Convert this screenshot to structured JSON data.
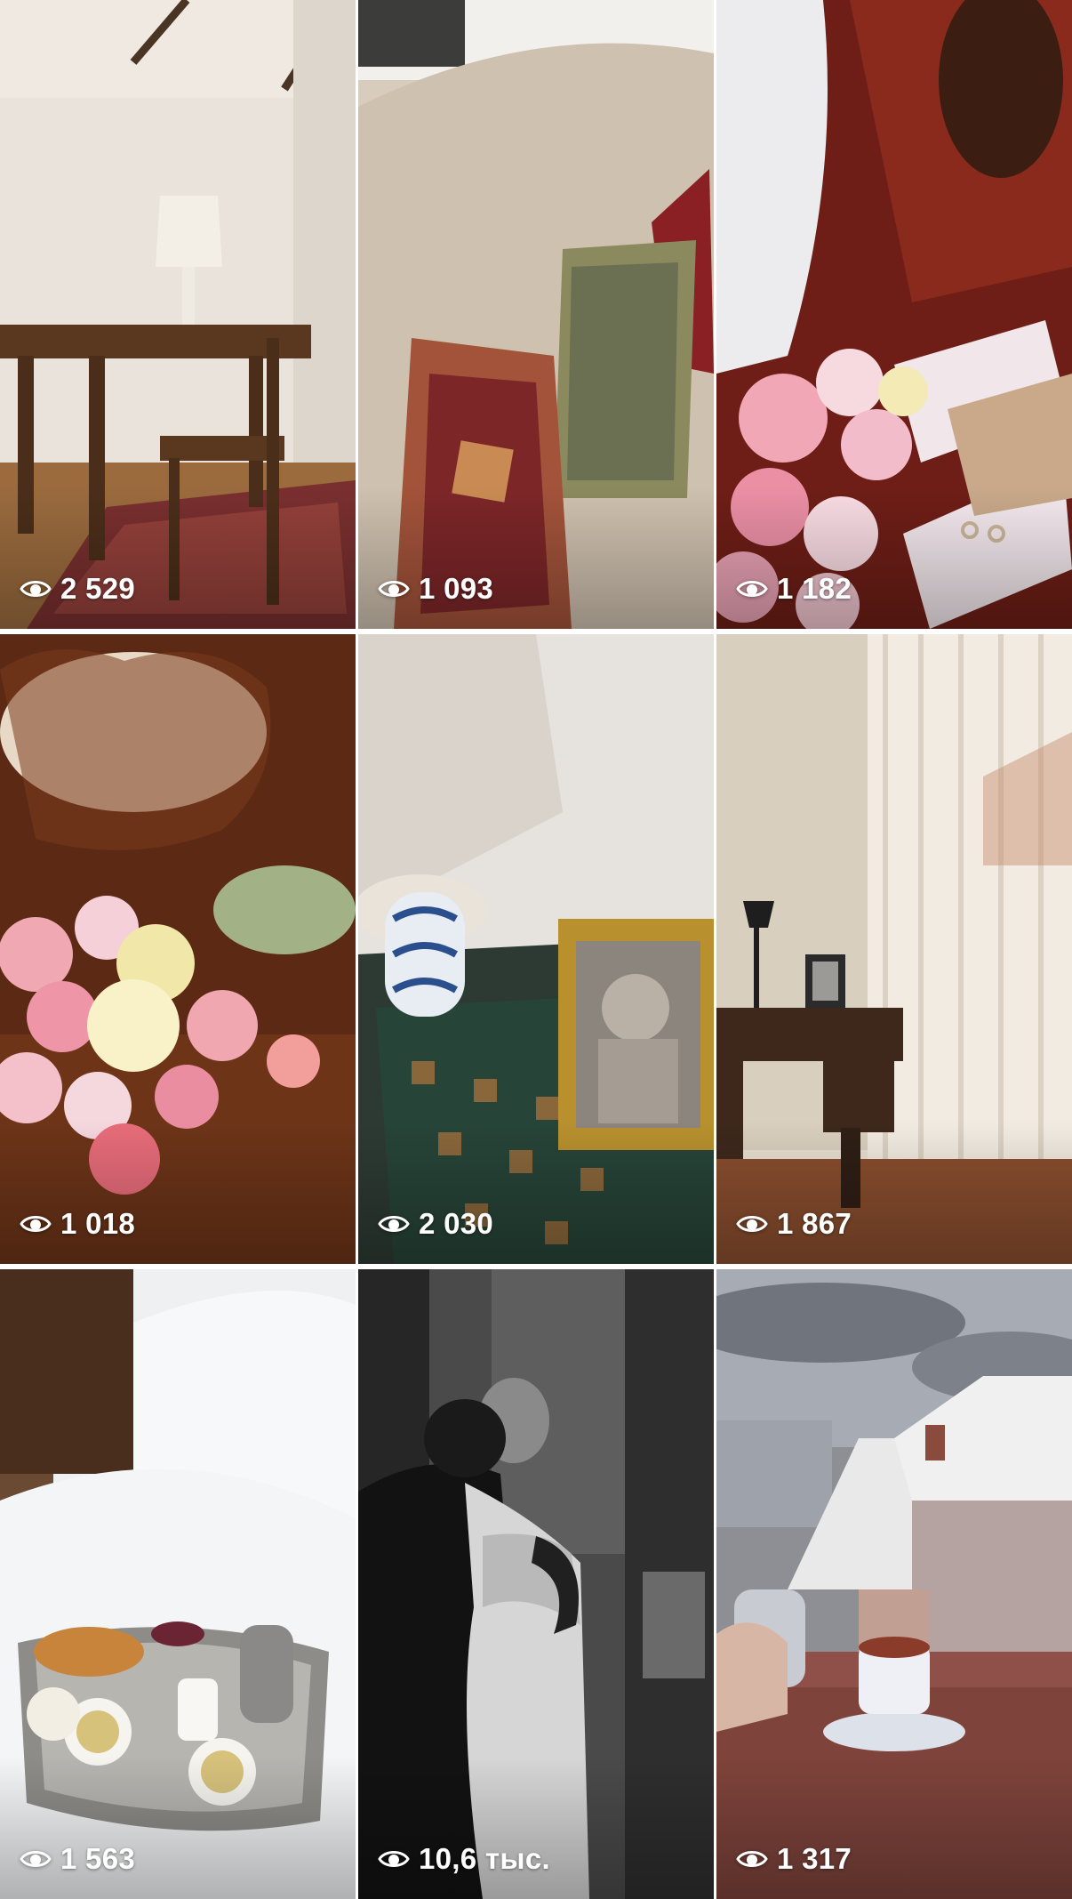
{
  "grid": {
    "tiles": [
      {
        "views": "2 529",
        "subject": "room-with-wooden-table-and-lamp"
      },
      {
        "views": "1 093",
        "subject": "sofa-with-embroidered-cushions"
      },
      {
        "views": "1 182",
        "subject": "bouquet-with-rings-and-envelope"
      },
      {
        "views": "1 018",
        "subject": "bouquet-on-carved-wood"
      },
      {
        "views": "2 030",
        "subject": "lamp-and-vintage-portrait-frame"
      },
      {
        "views": "1 867",
        "subject": "desk-by-sheer-curtains"
      },
      {
        "views": "1 563",
        "subject": "breakfast-tray-on-bed"
      },
      {
        "views": "10,6 тыс.",
        "subject": "black-and-white-couple-embrace"
      },
      {
        "views": "1 317",
        "subject": "tea-on-snowy-balcony"
      }
    ]
  },
  "icons": {
    "views_icon": "eye-icon"
  },
  "colors": {
    "overlay_text": "#ffffff",
    "background": "#ffffff"
  }
}
